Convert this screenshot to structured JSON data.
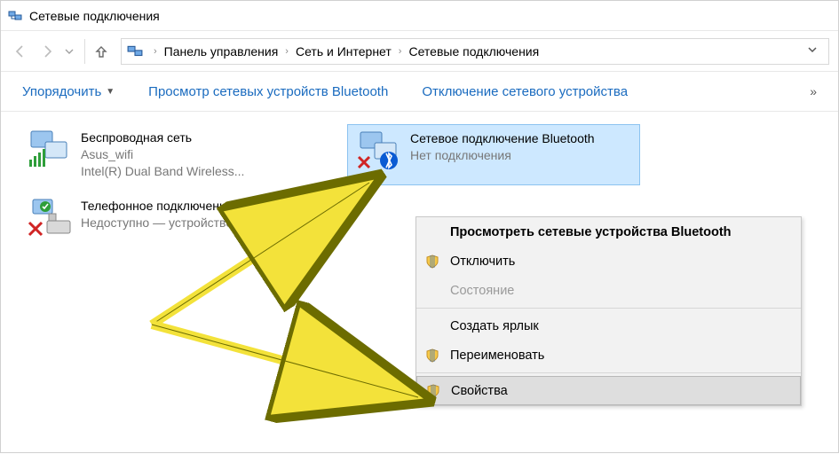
{
  "window": {
    "title": "Сетевые подключения"
  },
  "breadcrumb": {
    "items": [
      "Панель управления",
      "Сеть и Интернет",
      "Сетевые подключения"
    ]
  },
  "toolbar": {
    "organize": "Упорядочить",
    "view_bt": "Просмотр сетевых устройств Bluetooth",
    "disable": "Отключение сетевого устройства",
    "overflow": "»"
  },
  "connections": [
    {
      "name": "Беспроводная сеть",
      "status": "Asus_wifi",
      "device": "Intel(R) Dual Band Wireless...",
      "icon": "wifi",
      "selected": false
    },
    {
      "name": "Сетевое подключение Bluetooth",
      "status": "Нет подключения",
      "device": "",
      "icon": "bt-x",
      "selected": true
    },
    {
      "name": "Телефонное подключение к Интернету",
      "status": "Недоступно — устройство ...",
      "device": "",
      "icon": "phone-x",
      "selected": false
    }
  ],
  "context_menu": {
    "items": [
      {
        "label": "Просмотреть сетевые устройства Bluetooth",
        "bold": true,
        "shield": false,
        "disabled": false,
        "sep_after": false,
        "hover": false
      },
      {
        "label": "Отключить",
        "bold": false,
        "shield": true,
        "disabled": false,
        "sep_after": false,
        "hover": false
      },
      {
        "label": "Состояние",
        "bold": false,
        "shield": false,
        "disabled": true,
        "sep_after": true,
        "hover": false
      },
      {
        "label": "Создать ярлык",
        "bold": false,
        "shield": false,
        "disabled": false,
        "sep_after": false,
        "hover": false
      },
      {
        "label": "Переименовать",
        "bold": false,
        "shield": true,
        "disabled": false,
        "sep_after": true,
        "hover": false
      },
      {
        "label": "Свойства",
        "bold": false,
        "shield": true,
        "disabled": false,
        "sep_after": false,
        "hover": true
      }
    ]
  }
}
